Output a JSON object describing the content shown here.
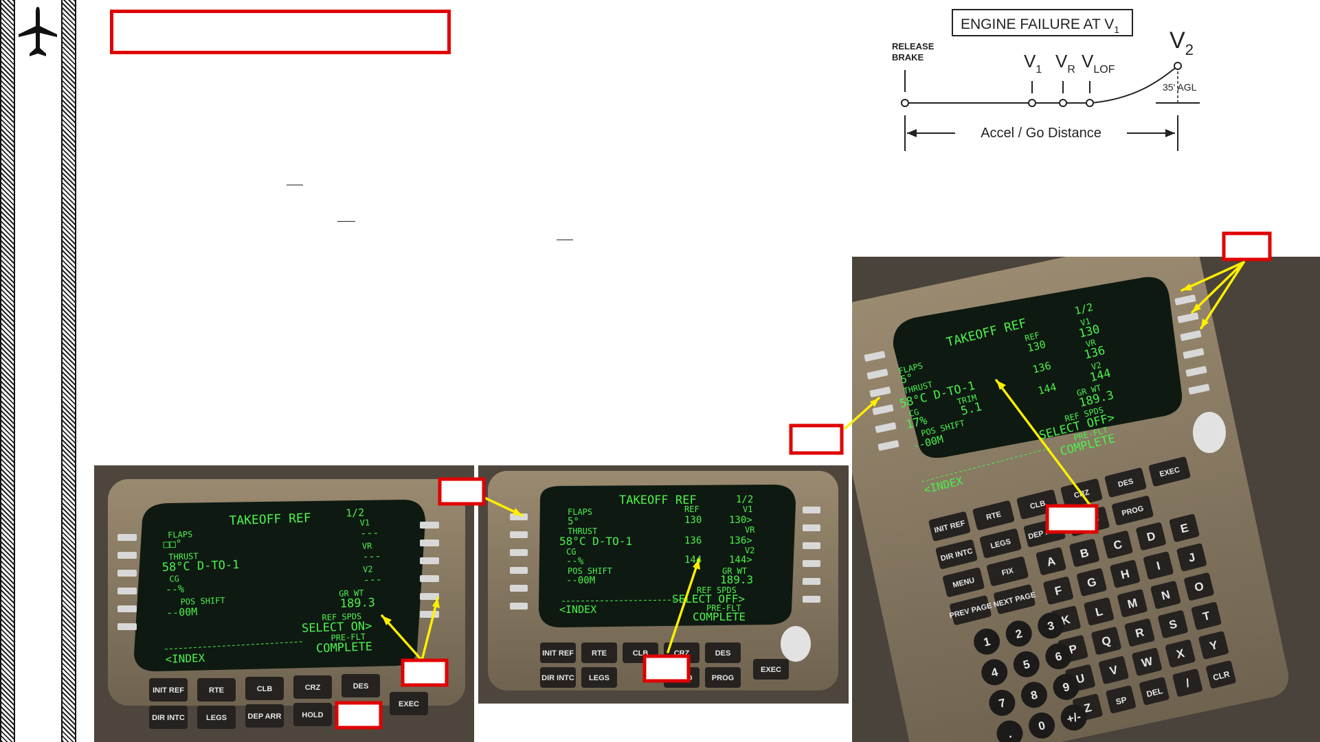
{
  "page": {
    "title_box": ""
  },
  "diagram": {
    "title": "ENGINE FAILURE AT V",
    "title_sub": "1",
    "release_brake": [
      "RELEASE",
      "BRAKE"
    ],
    "v1": "V",
    "v1_sub": "1",
    "vr": "V",
    "vr_sub": "R",
    "vlof": "V",
    "vlof_sub": "LOF",
    "v2": "V",
    "v2_sub": "2",
    "agl": "35' AGL",
    "distance": "Accel / Go Distance"
  },
  "cdu1": {
    "title": "TAKEOFF REF",
    "page": "1/2",
    "flaps_label": "FLAPS",
    "flaps_value": "□□°",
    "thrust_label": "THRUST",
    "thrust_value": "58°C D-TO-1",
    "cg_label": "CG",
    "cg_value": "--%",
    "pos_shift_label": "POS SHIFT",
    "pos_shift_value": "--00M",
    "v1_label": "V1",
    "v1_value": "---",
    "vr_label": "VR",
    "vr_value": "---",
    "v2_label": "V2",
    "v2_value": "---",
    "grwt_label": "GR WT",
    "grwt_value": "189.3",
    "refspds_label": "REF SPDS",
    "refspds_value": "SELECT ON>",
    "preflt_label": "PRE-FLT",
    "preflt_value": "COMPLETE",
    "index": "<INDEX"
  },
  "cdu2": {
    "title": "TAKEOFF REF",
    "page": "1/2",
    "flaps_label": "FLAPS",
    "flaps_value": "5°",
    "thrust_label": "THRUST",
    "thrust_value": "58°C D-TO-1",
    "cg_label": "CG",
    "cg_value": "--%",
    "pos_shift_label": "POS SHIFT",
    "pos_shift_value": "--00M",
    "ref_label": "REF",
    "ref1": "130",
    "ref2": "136",
    "ref3": "144",
    "v1_label": "V1",
    "v1_value": "130>",
    "vr_label": "VR",
    "vr_value": "136>",
    "v2_label": "V2",
    "v2_value": "144>",
    "grwt_label": "GR WT",
    "grwt_value": "189.3",
    "refspds_label": "REF SPDS",
    "refspds_value": "SELECT OFF>",
    "preflt_label": "PRE-FLT",
    "preflt_value": "COMPLETE",
    "index": "<INDEX"
  },
  "cdu3": {
    "title": "TAKEOFF REF",
    "page": "1/2",
    "flaps_label": "FLAPS",
    "flaps_value": "5°",
    "thrust_label": "THRUST",
    "thrust_value": "58°C D-TO-1",
    "cg_label": "CG",
    "cg_value": "17%",
    "trim_label": "TRIM",
    "trim_value": "5.1",
    "pos_shift_label": "POS SHIFT",
    "pos_shift_value": "--00M",
    "ref_label": "REF",
    "ref1": "130",
    "ref2": "136",
    "ref3": "144",
    "v1_label": "V1",
    "v1_value": "130",
    "vr_label": "VR",
    "vr_value": "136",
    "v2_label": "V2",
    "v2_value": "144",
    "grwt_label": "GR WT",
    "grwt_value": "189.3",
    "refspds_label": "REF SPDS",
    "refspds_value": "SELECT OFF>",
    "preflt_label": "PRE-FLT",
    "preflt_value": "COMPLETE",
    "index": "<INDEX"
  },
  "keys_row1": [
    "INIT REF",
    "RTE",
    "CLB",
    "CRZ",
    "DES"
  ],
  "keys_row2": [
    "DIR INTC",
    "LEGS",
    "DEP ARR",
    "HOLD",
    "PROG",
    "EXEC"
  ],
  "keys_row3": [
    "MENU",
    "FIX",
    "PREV PAGE",
    "NEXT PAGE"
  ],
  "keypad_letters": [
    "A",
    "B",
    "C",
    "D",
    "E",
    "F",
    "G",
    "H",
    "I",
    "J",
    "K",
    "L",
    "M",
    "N",
    "O",
    "P",
    "Q",
    "R",
    "S",
    "T",
    "U",
    "V",
    "W",
    "X",
    "Y",
    "Z",
    "SP",
    "DEL",
    "/",
    "CLR"
  ],
  "keypad_numbers": [
    "1",
    "2",
    "3",
    "4",
    "5",
    "6",
    "7",
    "8",
    "9",
    ".",
    "0",
    "+/-"
  ],
  "colors": {
    "screen_text": "#4cf24c",
    "highlight_box": "#e00000",
    "arrow": "#ffef00",
    "bezel": "#8a7a63"
  },
  "icons": {
    "logo": "airplane-icon"
  }
}
